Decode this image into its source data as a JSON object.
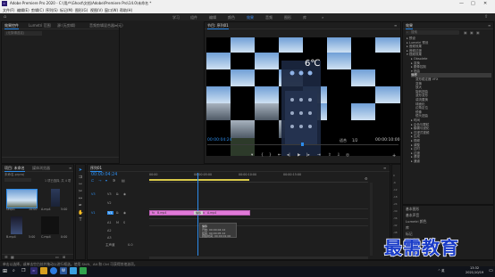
{
  "titlebar": {
    "app_icon": "Pr",
    "title": "Adobe Premiere Pro 2020 - C:\\用户\\Ghost\\文档\\Adobe\\Premiere Pro\\14.0\\未命名 *",
    "minimize": "—",
    "maximize": "□",
    "close": "✕"
  },
  "menu": [
    "文件(F)",
    "编辑(E)",
    "剪辑(C)",
    "序列(S)",
    "标记(M)",
    "图形(G)",
    "视图(V)",
    "窗口(W)",
    "帮助(H)"
  ],
  "workspaces": {
    "home_icon": "home-icon",
    "items": [
      "学习",
      "组件",
      "编辑",
      "颜色",
      "效果",
      "音频",
      "图形",
      "库"
    ],
    "active": "效果",
    "more": "»",
    "share_icon": "share-icon"
  },
  "source_panel": {
    "tabs": [
      "效果控件",
      "Lumetri 范围",
      "源:(无剪辑)",
      "音频剪辑混合器: (无)"
    ],
    "menu": "≡",
    "clip_label": "(无剪辑选定)"
  },
  "program_monitor": {
    "title": "节目: 序列01",
    "menu": "≡",
    "timecode": "00:00:04:24",
    "fit": "适合",
    "quality": "1/2",
    "duration": "00:00:10:00",
    "overlay_text": "6℃"
  },
  "effects_panel": {
    "title": "效果",
    "menu": "≡",
    "search_placeholder": "搜索",
    "items": [
      {
        "label": "▸ 预设"
      },
      {
        "label": "▸ Lumetri 预设"
      },
      {
        "label": "▸ 音频效果"
      },
      {
        "label": "▸ 音频过渡"
      },
      {
        "label": "▾ 视频效果"
      },
      {
        "label": "▸ Obsolete"
      },
      {
        "label": "▸ 变换"
      },
      {
        "label": "▸ 图像控制"
      },
      {
        "label": "▾ 扭曲"
      },
      {
        "label": "偏移"
      },
      {
        "label": "变形稳定器 VFX"
      },
      {
        "label": "变换"
      },
      {
        "label": "放大"
      },
      {
        "label": "旋转扭曲"
      },
      {
        "label": "波形变形"
      },
      {
        "label": "湍流置换"
      },
      {
        "label": "球面化"
      },
      {
        "label": "边角定位"
      },
      {
        "label": "镜像"
      },
      {
        "label": "镜头扭曲"
      },
      {
        "label": "▸ 时间"
      },
      {
        "label": "▸ 杂色与颗粒"
      },
      {
        "label": "▸ 模糊与锐化"
      },
      {
        "label": "▸ 沉浸式视频"
      },
      {
        "label": "▸ 生成"
      },
      {
        "label": "▸ 视频"
      },
      {
        "label": "▸ 调整"
      },
      {
        "label": "▸ 过时"
      },
      {
        "label": "▸ 过渡"
      },
      {
        "label": "▸ 透视"
      },
      {
        "label": "▸ 通道"
      }
    ],
    "selected_index": 9,
    "essential": [
      "基本图形",
      "基本声音",
      "Lumetri 颜色",
      "库",
      "标记",
      "历史记录",
      "信息"
    ]
  },
  "project_panel": {
    "tabs": [
      "项目: 未命名",
      "媒体浏览器"
    ],
    "menu": "≡",
    "project_file": "未命名.prproj",
    "count": "1 项已选择, 共 4 项",
    "clips": [
      {
        "name": "seq01",
        "dur": "10:00"
      },
      {
        "name": "A.mp4",
        "dur": "5:00"
      },
      {
        "name": "B.mp4",
        "dur": "5:00"
      },
      {
        "name": "C.mp4",
        "dur": "0:00"
      }
    ]
  },
  "timeline": {
    "sequence_tab": "序列01",
    "menu": "≡",
    "timecode": "00:00:04:24",
    "ruler": [
      "00:00",
      "00:00:05:00",
      "00:00:10:00",
      "00:00:15:00"
    ],
    "tracks": [
      {
        "label": "V3",
        "badge": "V3"
      },
      {
        "label": "V2",
        "badge": "V2"
      },
      {
        "label": "V1",
        "badge": "V1"
      },
      {
        "label": "A1",
        "badge": "A1"
      },
      {
        "label": "A2",
        "badge": "A2"
      },
      {
        "label": "A3",
        "badge": "A3"
      }
    ],
    "master": "主声道",
    "master_value": "0.0",
    "clips": [
      {
        "name": "B.mp4",
        "track": "V1"
      },
      {
        "name": "A.mp4",
        "track": "V1"
      }
    ],
    "tooltip": {
      "name": "偏移",
      "lines": [
        "开始: 00:00:04:12",
        "结束: 00:00:05:12",
        "持续时间: 00:00:01:00"
      ]
    }
  },
  "audio_meter": {
    "labels": [
      "0",
      "-6",
      "-12",
      "-18",
      "-24",
      "-30",
      "-36",
      "-42",
      "-48",
      "-54",
      "dB"
    ],
    "solo": "S S"
  },
  "statusbar": {
    "text": "单击以选择，或单击空白处并拖动以进行框选。使用 Shift、Alt 和 Ctrl 可获得其他选项。"
  },
  "taskbar": {
    "time": "13:32",
    "date": "2021/10/19",
    "tray": "^ 英"
  },
  "watermark": {
    "text": "最需教育"
  },
  "colors": {
    "accent": "#2d8ceb",
    "clip_pink": "#e07ad8",
    "watermark_blue": "#1a3cc8"
  }
}
